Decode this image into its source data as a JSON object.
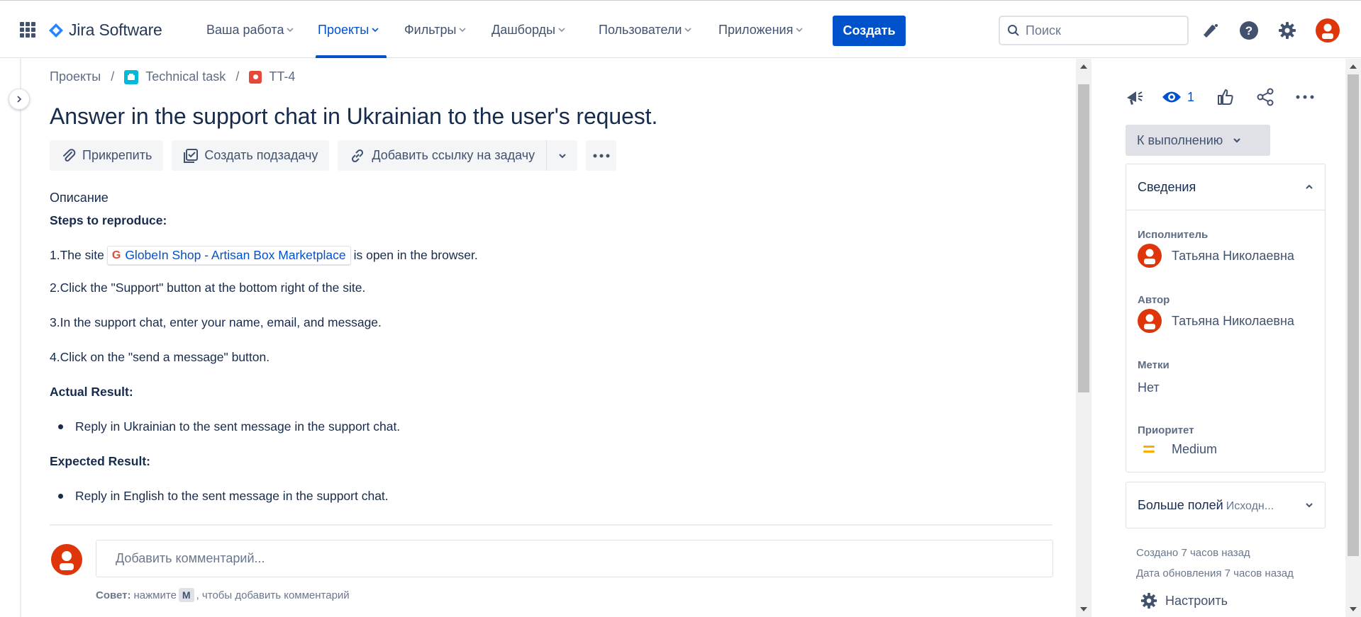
{
  "brand": {
    "name": "Jira Software",
    "color": "#0052cc"
  },
  "nav": {
    "items": [
      {
        "label": "Ваша работа",
        "active": false
      },
      {
        "label": "Проекты",
        "active": true
      },
      {
        "label": "Фильтры",
        "active": false
      },
      {
        "label": "Дашборды",
        "active": false
      },
      {
        "label": "Пользователи",
        "active": false
      },
      {
        "label": "Приложения",
        "active": false
      }
    ],
    "create_label": "Создать",
    "search_placeholder": "Поиск",
    "icons": [
      "app-switcher-icon",
      "notifications-icon",
      "help-icon",
      "settings-icon",
      "user-avatar"
    ]
  },
  "breadcrumb": {
    "items": [
      "Проекты",
      "Technical task",
      "TT-4"
    ]
  },
  "issue": {
    "title": "Answer in the support chat in Ukrainian to the user's request."
  },
  "toolbar": {
    "attach_label": "Прикрепить",
    "subtask_label": "Создать подзадачу",
    "link_label": "Добавить ссылку на задачу"
  },
  "description": {
    "label": "Описание",
    "steps_heading": "Steps to reproduce:",
    "step1_prefix": "1.The site",
    "step1_link": "GlobeIn Shop - Artisan Box Marketplace",
    "step1_suffix": "is open in the browser.",
    "step2": "2.Click the \"Support\" button at the bottom right of the site.",
    "step3": "3.In the support chat, enter your name, email, and message.",
    "step4": "4.Click on the \"send a message\" button.",
    "actual_heading": "Actual Result:",
    "actual_item": "Reply in Ukrainian to the sent message in the support chat.",
    "expected_heading": "Expected Result:",
    "expected_item": "Reply in English to the sent message in the support chat."
  },
  "comment": {
    "placeholder": "Добавить комментарий...",
    "tip_bold": "Совет:",
    "tip_press": "нажмите",
    "tip_key": "M",
    "tip_rest": ", чтобы добавить комментарий"
  },
  "sidebar": {
    "watch_count": "1",
    "status_label": "К выполнению",
    "details_title": "Сведения",
    "assignee_label": "Исполнитель",
    "assignee_value": "Татьяна Николаевна",
    "reporter_label": "Автор",
    "reporter_value": "Татьяна Николаевна",
    "labels_label": "Метки",
    "labels_value": "Нет",
    "priority_label": "Приоритет",
    "priority_value": "Medium",
    "more_fields_label": "Больше полей",
    "more_fields_sub": "Исходн...",
    "created": "Создано 7 часов назад",
    "updated": "Дата обновления 7 часов назад",
    "configure_label": "Настроить"
  }
}
